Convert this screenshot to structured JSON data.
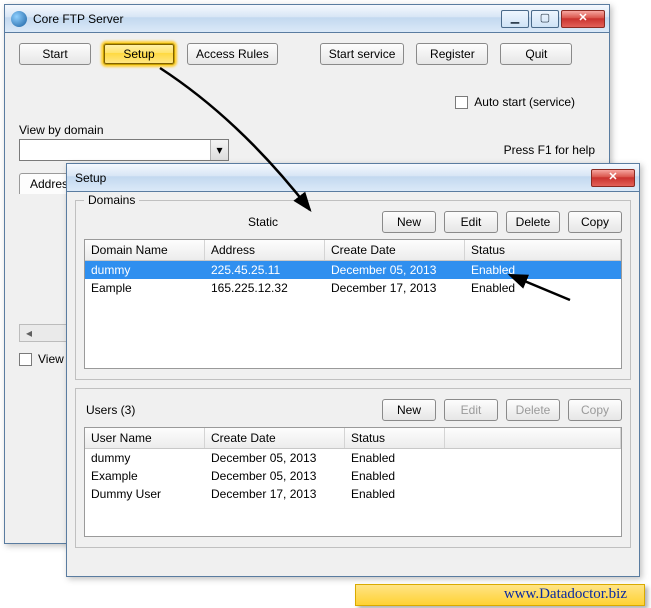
{
  "main_window": {
    "title": "Core FTP Server",
    "toolbar": {
      "start": "Start",
      "setup": "Setup",
      "access_rules": "Access Rules",
      "start_service": "Start service",
      "register": "Register",
      "quit": "Quit"
    },
    "auto_start_label": "Auto start (service)",
    "view_by_domain_label": "View by domain",
    "help_text": "Press F1 for help",
    "tab_address": "Address",
    "view_checkbox_label": "View"
  },
  "setup_window": {
    "title": "Setup",
    "domains": {
      "legend": "Domains",
      "static_label": "Static",
      "buttons": {
        "new": "New",
        "edit": "Edit",
        "delete": "Delete",
        "copy": "Copy"
      },
      "columns": {
        "domain_name": "Domain Name",
        "address": "Address",
        "create_date": "Create Date",
        "status": "Status"
      },
      "rows": [
        {
          "domain_name": "dummy",
          "address": "225.45.25.11",
          "create_date": "December 05, 2013",
          "status": "Enabled",
          "selected": true
        },
        {
          "domain_name": "Eample",
          "address": "165.225.12.32",
          "create_date": "December 17, 2013",
          "status": "Enabled",
          "selected": false
        }
      ]
    },
    "users": {
      "legend": "Users (3)",
      "buttons": {
        "new": "New",
        "edit": "Edit",
        "delete": "Delete",
        "copy": "Copy"
      },
      "columns": {
        "user_name": "User Name",
        "create_date": "Create Date",
        "status": "Status"
      },
      "rows": [
        {
          "user_name": "dummy",
          "create_date": "December 05, 2013",
          "status": "Enabled"
        },
        {
          "user_name": "Example",
          "create_date": "December 05, 2013",
          "status": "Enabled"
        },
        {
          "user_name": "Dummy User",
          "create_date": "December 17, 2013",
          "status": "Enabled"
        }
      ]
    }
  },
  "footer_link": "www.Datadoctor.biz"
}
